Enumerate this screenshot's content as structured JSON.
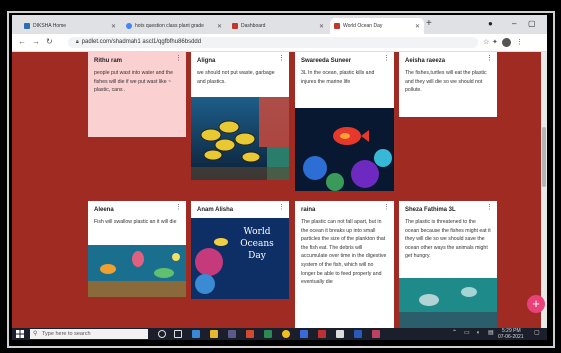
{
  "tabs": [
    {
      "title": "DIKSHA Home",
      "active": false
    },
    {
      "title": "hots question class plant grade",
      "active": false
    },
    {
      "title": "Dashboard",
      "active": false
    },
    {
      "title": "World Ocean Day",
      "active": true
    }
  ],
  "address": "padlet.com/shadmah1 ascl1/qgfbfhu86bsddd",
  "cards": [
    {
      "name": "Rithu ram",
      "text": "people put wast into water and the fishes will die if we put wast like ~ plastic, cans ."
    },
    {
      "name": "Aligna",
      "text": "we should not put waste, garbage and plastics."
    },
    {
      "name": "Swareeda Suneer",
      "text": "3L In the ocean, plastic kills and injures the marine life"
    },
    {
      "name": "Aeisha raeeza",
      "text": "The fishes,turtles will eat the plastic and they will die so we should not pollute."
    },
    {
      "name": "Aleena",
      "text": "Fish will swallow plastic an it will die"
    },
    {
      "name": "Anam Alisha",
      "text": ""
    },
    {
      "name": "raina",
      "text": "The plastic can not fall apart, but in the ocean it breaks up into small particles the size of the plankton that the fish eat. The debris will accumulate over time in the digestive system of the fish, which will no longer be able to feed properly and eventually die"
    },
    {
      "name": "Sheza Fathima 3L",
      "text": "The plastic is threatened to the ocean because the fishes might eat it they will die so we should save the ocean other ways the animals might get hungry."
    }
  ],
  "poster_text": "World Oceans Day",
  "taskbar": {
    "search_placeholder": "Type here to search",
    "time": "5:29 PM",
    "date": "07-06-2021"
  },
  "fab_label": "+",
  "icons": {
    "menu": "more-vert",
    "close": "close",
    "back": "arrow-left",
    "forward": "arrow-right",
    "reload": "reload"
  },
  "colors": {
    "padlet_bg": "#a02b22",
    "fab": "#e9417a",
    "pink_card": "#fbd0d0"
  }
}
